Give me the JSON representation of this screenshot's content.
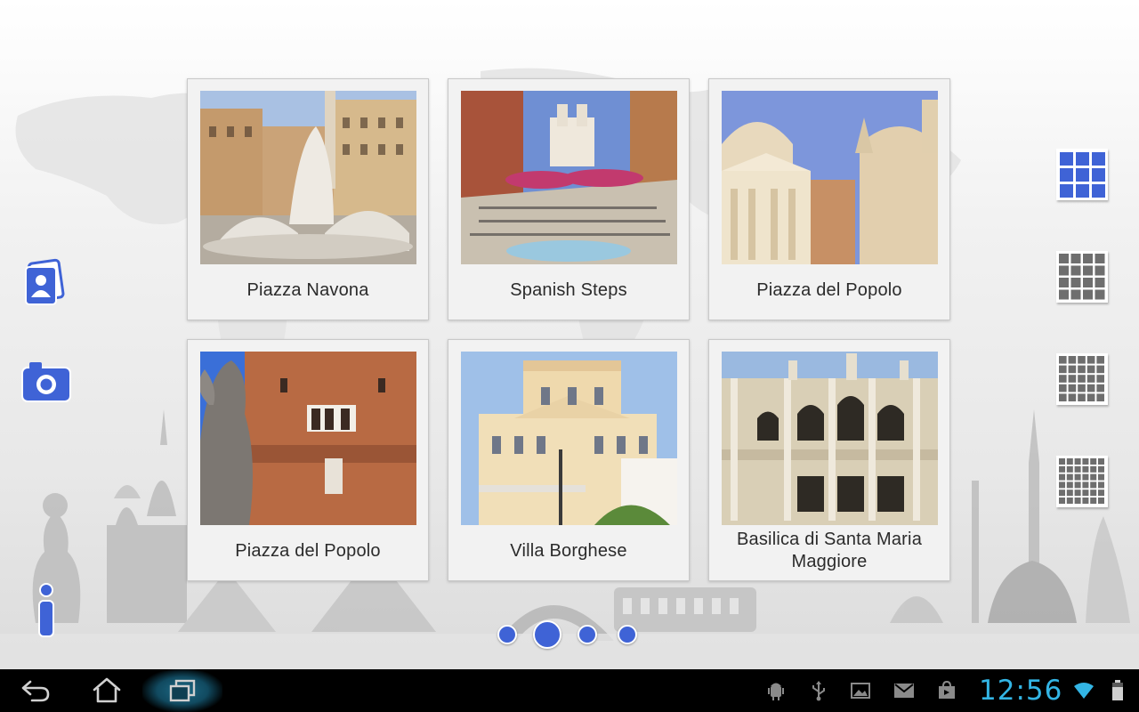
{
  "places": [
    {
      "title": "Piazza Navona"
    },
    {
      "title": "Spanish Steps"
    },
    {
      "title": "Piazza del Popolo"
    },
    {
      "title": "Piazza del Popolo"
    },
    {
      "title": "Villa Borghese"
    },
    {
      "title": "Basilica di Santa Maria Maggiore"
    }
  ],
  "left_rail": {
    "icons": [
      "album-icon",
      "camera-icon",
      "info-icon"
    ]
  },
  "right_rail": {
    "grid_options": [
      "grid-3x3-icon",
      "grid-4x4-icon",
      "grid-5x5-icon",
      "grid-6x6-icon"
    ],
    "selected_index": 0
  },
  "pager": {
    "page_count": 4,
    "current_page": 2
  },
  "status_bar": {
    "time": "12:56",
    "icons": [
      "android-debug-icon",
      "usb-icon",
      "gallery-notification-icon",
      "gmail-icon",
      "store-notification-icon",
      "wifi-icon",
      "battery-icon"
    ]
  },
  "nav_bar": {
    "icons": [
      "back-icon",
      "home-icon",
      "recent-apps-icon"
    ]
  },
  "colors": {
    "accent_blue": "#3f63d6",
    "clock": "#33b5e5",
    "system_bar": "#000000"
  }
}
